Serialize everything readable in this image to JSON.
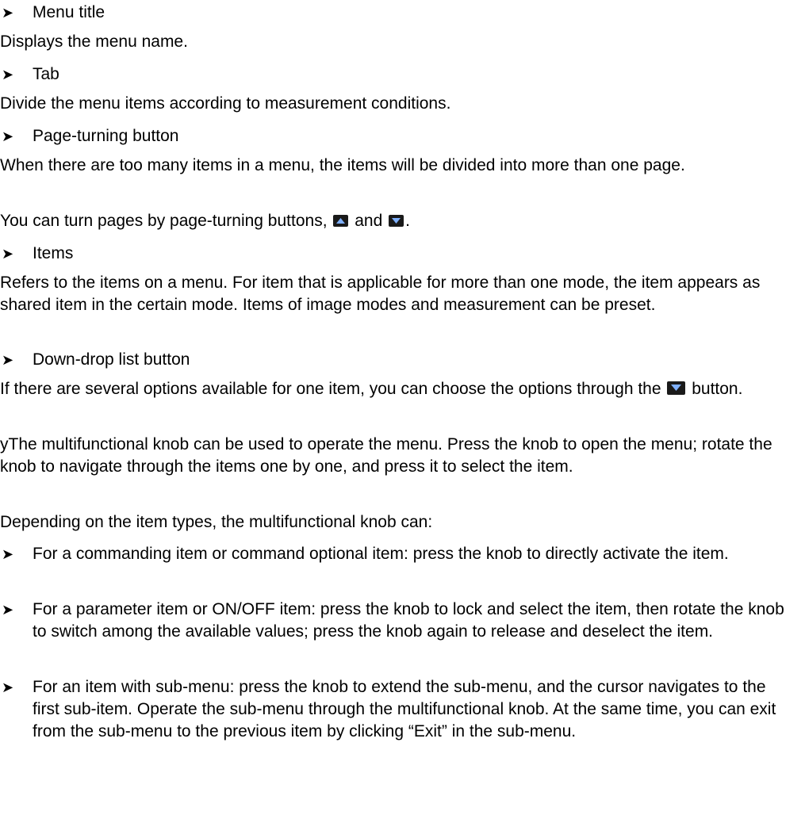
{
  "bullet_glyph": "➤",
  "sections": {
    "menu_title": {
      "heading": "Menu title",
      "body": "Displays the menu name."
    },
    "tab": {
      "heading": "Tab",
      "body": "Divide the menu items according to measurement conditions."
    },
    "page_turning": {
      "heading": "Page-turning button",
      "body_1": "When there are too many items in a menu, the items will be divided into more than one page.",
      "body_2_prefix": "You can turn pages by page-turning buttons,",
      "body_2_mid": "and",
      "body_2_suffix": "."
    },
    "items": {
      "heading": "Items",
      "body": "Refers to the items on a menu. For item that is applicable for more than one mode, the item appears as shared item in the certain mode. Items of image modes and measurement can be preset."
    },
    "dropdown": {
      "heading": "Down-drop list button",
      "body_prefix": "If there are several options available for one item, you can choose the options through the",
      "body_suffix": "button."
    }
  },
  "knob": {
    "intro": "yThe multifunctional knob can be used to operate the menu. Press the knob to open the menu; rotate the knob to navigate through the items one by one, and press it to select the item.",
    "lead": "Depending on the item types, the multifunctional knob can:",
    "bullets": [
      "For a commanding item or command optional item: press the knob to directly activate the item.",
      "For a parameter item or ON/OFF item: press the knob to lock and select the item, then rotate the knob to switch among the available values; press the knob again to release and deselect the item.",
      "For an item with sub-menu: press the knob to extend the sub-menu, and the cursor navigates to the first sub-item. Operate the sub-menu through the multifunctional knob. At the same time, you can exit from the sub-menu to the previous item by clicking “Exit” in the sub-menu."
    ]
  },
  "icons": {
    "page_up": "triangle-up-icon",
    "page_down": "triangle-down-icon",
    "dropdown": "triangle-down-icon"
  },
  "colors": {
    "text": "#000000",
    "icon_bg": "#1a1a1a",
    "icon_glyph": "#7fb0ff"
  }
}
